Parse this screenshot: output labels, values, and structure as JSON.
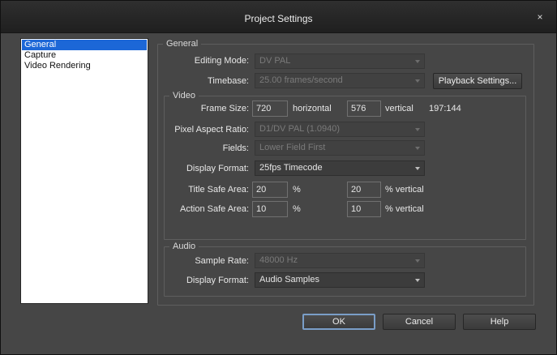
{
  "window": {
    "title": "Project Settings",
    "close_glyph": "×"
  },
  "nav": {
    "items": [
      "General",
      "Capture",
      "Video Rendering"
    ],
    "selected": "General"
  },
  "general": {
    "legend": "General",
    "editing_mode_label": "Editing Mode:",
    "editing_mode_value": "DV PAL",
    "timebase_label": "Timebase:",
    "timebase_value": "25.00 frames/second",
    "playback_button": "Playback Settings..."
  },
  "video": {
    "legend": "Video",
    "frame_size_label": "Frame Size:",
    "frame_width": "720",
    "horizontal_label": "horizontal",
    "frame_height": "576",
    "vertical_label": "vertical",
    "aspect_ratio_text": "197:144",
    "pixel_aspect_label": "Pixel Aspect Ratio:",
    "pixel_aspect_value": "D1/DV PAL (1.0940)",
    "fields_label": "Fields:",
    "fields_value": "Lower Field First",
    "display_format_label": "Display Format:",
    "display_format_value": "25fps Timecode",
    "title_safe_label": "Title Safe Area:",
    "title_safe_h": "20",
    "title_safe_v": "20",
    "action_safe_label": "Action Safe Area:",
    "action_safe_h": "10",
    "action_safe_v": "10",
    "percent_label": "%",
    "percent_vertical_label": "% vertical"
  },
  "audio": {
    "legend": "Audio",
    "sample_rate_label": "Sample Rate:",
    "sample_rate_value": "48000 Hz",
    "display_format_label": "Display Format:",
    "display_format_value": "Audio Samples"
  },
  "buttons": {
    "ok": "OK",
    "cancel": "Cancel",
    "help": "Help"
  },
  "icons": {
    "close": "close-icon",
    "dropdown": "chevron-down-icon"
  },
  "colors": {
    "selection": "#1c67d7",
    "default_button_ring": "#7a9ec8"
  }
}
